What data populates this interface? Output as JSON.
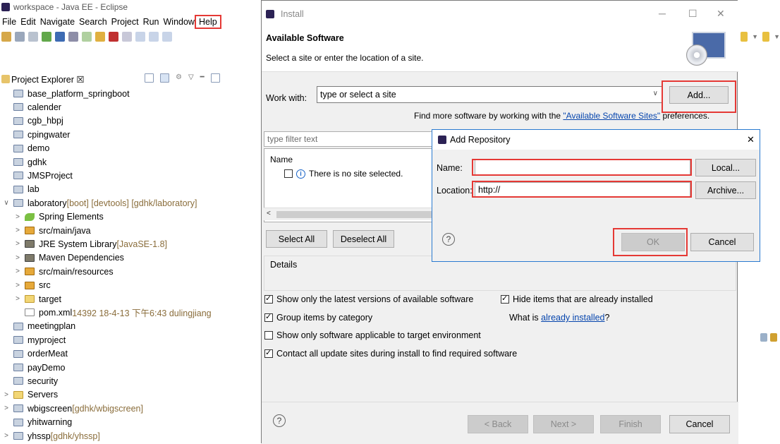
{
  "eclipse": {
    "window_title": "workspace - Java EE - Eclipse",
    "menu": [
      "File",
      "Edit",
      "Navigate",
      "Search",
      "Project",
      "Run",
      "Window",
      "Help"
    ],
    "project_explorer_label": "Project Explorer ☒",
    "tree": [
      {
        "label": "base_platform_springboot",
        "extra": "",
        "icon": "folder",
        "twist": "",
        "level": 0
      },
      {
        "label": "calender",
        "extra": "",
        "icon": "folder",
        "twist": "",
        "level": 0
      },
      {
        "label": "cgb_hbpj",
        "extra": "",
        "icon": "folder",
        "twist": "",
        "level": 0
      },
      {
        "label": "cpingwater",
        "extra": "",
        "icon": "folder",
        "twist": "",
        "level": 0
      },
      {
        "label": "demo",
        "extra": "",
        "icon": "folder",
        "twist": "",
        "level": 0
      },
      {
        "label": "gdhk",
        "extra": "",
        "icon": "folder",
        "twist": "",
        "level": 0
      },
      {
        "label": "JMSProject",
        "extra": "",
        "icon": "folder",
        "twist": "",
        "level": 0
      },
      {
        "label": "lab",
        "extra": "",
        "icon": "folder",
        "twist": "",
        "level": 0
      },
      {
        "label": "laboratory",
        "extra": " [boot] [devtools] [gdhk/laboratory]",
        "icon": "folder",
        "twist": "∨",
        "level": 0
      },
      {
        "label": "Spring Elements",
        "extra": "",
        "icon": "leaf",
        "twist": ">",
        "level": 1
      },
      {
        "label": "src/main/java",
        "extra": "",
        "icon": "pkg",
        "twist": ">",
        "level": 1
      },
      {
        "label": "JRE System Library",
        "extra": " [JavaSE-1.8]",
        "icon": "jar",
        "twist": ">",
        "level": 1
      },
      {
        "label": "Maven Dependencies",
        "extra": "",
        "icon": "jar",
        "twist": ">",
        "level": 1
      },
      {
        "label": "src/main/resources",
        "extra": "",
        "icon": "pkg",
        "twist": ">",
        "level": 1
      },
      {
        "label": "src",
        "extra": "",
        "icon": "pkg",
        "twist": ">",
        "level": 1
      },
      {
        "label": "target",
        "extra": "",
        "icon": "yfolder",
        "twist": ">",
        "level": 1
      },
      {
        "label": "pom.xml",
        "extra": " 14392  18-4-13 下午6:43  dulingjiang",
        "icon": "xml",
        "twist": "",
        "level": 1
      },
      {
        "label": "meetingplan",
        "extra": "",
        "icon": "folder",
        "twist": "",
        "level": 0
      },
      {
        "label": "myproject",
        "extra": "",
        "icon": "folder",
        "twist": "",
        "level": 0
      },
      {
        "label": "orderMeat",
        "extra": "",
        "icon": "folder",
        "twist": "",
        "level": 0
      },
      {
        "label": "payDemo",
        "extra": "",
        "icon": "folder",
        "twist": "",
        "level": 0
      },
      {
        "label": "security",
        "extra": "",
        "icon": "folder",
        "twist": "",
        "level": 0
      },
      {
        "label": "Servers",
        "extra": "",
        "icon": "yfolder",
        "twist": ">",
        "level": 0
      },
      {
        "label": "wbigscreen",
        "extra": " [gdhk/wbigscreen]",
        "icon": "folder",
        "twist": ">",
        "level": 0
      },
      {
        "label": "yhitwarning",
        "extra": "",
        "icon": "folder",
        "twist": "",
        "level": 0
      },
      {
        "label": "yhssp",
        "extra": " [gdhk/yhssp]",
        "icon": "folder",
        "twist": ">",
        "level": 0
      }
    ]
  },
  "install": {
    "title": "Install",
    "heading": "Available Software",
    "subheading": "Select a site or enter the location of a site.",
    "work_with_label": "Work with:",
    "site_value": "type or select a site",
    "add_button": "Add...",
    "find_more_prefix": "Find more software by working with the ",
    "find_more_link": "\"Available Software Sites\"",
    "find_more_suffix": " preferences.",
    "filter_placeholder": "type filter text",
    "col_name": "Name",
    "no_site": "There is no site selected.",
    "select_all": "Select All",
    "deselect_all": "Deselect All",
    "details": "Details",
    "opt_latest": "Show only the latest versions of available software",
    "opt_hide": "Hide items that are already installed",
    "opt_group": "Group items by category",
    "what_is_prefix": "What is ",
    "what_is_link": "already installed",
    "what_is_suffix": "?",
    "opt_target": "Show only software applicable to target environment",
    "opt_contact": "Contact all update sites during install to find required software",
    "back": "< Back",
    "next": "Next >",
    "finish": "Finish",
    "cancel": "Cancel"
  },
  "add_repo": {
    "title": "Add Repository",
    "name_label": "Name:",
    "name_value": "",
    "location_label": "Location:",
    "location_value": "http://",
    "local_button": "Local...",
    "archive_button": "Archive...",
    "ok": "OK",
    "cancel": "Cancel"
  },
  "colors": {
    "highlight": "#e53935",
    "link": "#0645ad"
  }
}
